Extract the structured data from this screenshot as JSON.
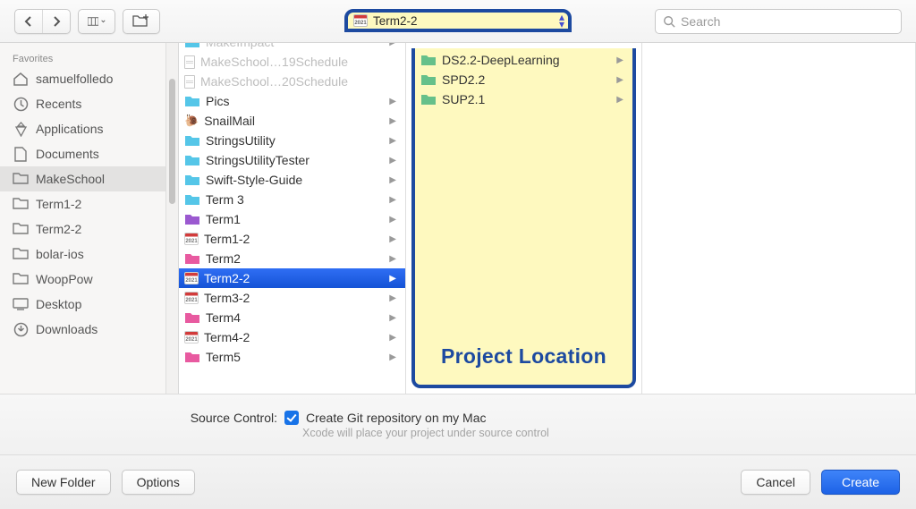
{
  "toolbar": {
    "path_value": "Term2-2",
    "path_year": "2021",
    "search_placeholder": "Search"
  },
  "sidebar": {
    "section": "Favorites",
    "items": [
      {
        "label": "samuelfolledo",
        "icon": "home"
      },
      {
        "label": "Recents",
        "icon": "clock"
      },
      {
        "label": "Applications",
        "icon": "apps"
      },
      {
        "label": "Documents",
        "icon": "doc"
      },
      {
        "label": "MakeSchool",
        "icon": "folder",
        "selected": true
      },
      {
        "label": "Term1-2",
        "icon": "folder"
      },
      {
        "label": "Term2-2",
        "icon": "folder"
      },
      {
        "label": "bolar-ios",
        "icon": "folder"
      },
      {
        "label": "WoopPow",
        "icon": "folder"
      },
      {
        "label": "Desktop",
        "icon": "desktop"
      },
      {
        "label": "Downloads",
        "icon": "download"
      }
    ]
  },
  "col1": [
    {
      "label": "MakeImpact",
      "icon": "f-cyan",
      "chev": true,
      "dim": true,
      "cut": true
    },
    {
      "label": "MakeSchool…19Schedule",
      "icon": "doc",
      "dim": true
    },
    {
      "label": "MakeSchool…20Schedule",
      "icon": "doc",
      "dim": true
    },
    {
      "label": "Pics",
      "icon": "f-cyan",
      "chev": true
    },
    {
      "label": "SnailMail",
      "icon": "snail",
      "chev": true
    },
    {
      "label": "StringsUtility",
      "icon": "f-cyan",
      "chev": true
    },
    {
      "label": "StringsUtilityTester",
      "icon": "f-cyan",
      "chev": true
    },
    {
      "label": "Swift-Style-Guide",
      "icon": "f-cyan",
      "chev": true
    },
    {
      "label": "Term 3",
      "icon": "f-cyan",
      "chev": true
    },
    {
      "label": "Term1",
      "icon": "f-purple",
      "chev": true
    },
    {
      "label": "Term1-2",
      "icon": "cal",
      "chev": true
    },
    {
      "label": "Term2",
      "icon": "f-pink",
      "chev": true
    },
    {
      "label": "Term2-2",
      "icon": "cal",
      "chev": true,
      "selected": true
    },
    {
      "label": "Term3-2",
      "icon": "cal",
      "chev": true
    },
    {
      "label": "Term4",
      "icon": "f-pink",
      "chev": true
    },
    {
      "label": "Term4-2",
      "icon": "cal",
      "chev": true
    },
    {
      "label": "Term5",
      "icon": "f-pink",
      "chev": true
    }
  ],
  "col2": [
    {
      "label": "DS2.2-DeepLearning",
      "icon": "f-green",
      "chev": true
    },
    {
      "label": "SPD2.2",
      "icon": "f-green",
      "chev": true
    },
    {
      "label": "SUP2.1",
      "icon": "f-green",
      "chev": true
    }
  ],
  "annotation": "Project Location",
  "source_control": {
    "label": "Source Control:",
    "checkbox_label": "Create Git repository on my Mac",
    "subtext": "Xcode will place your project under source control"
  },
  "buttons": {
    "new_folder": "New Folder",
    "options": "Options",
    "cancel": "Cancel",
    "create": "Create"
  },
  "cal_year": "2021"
}
